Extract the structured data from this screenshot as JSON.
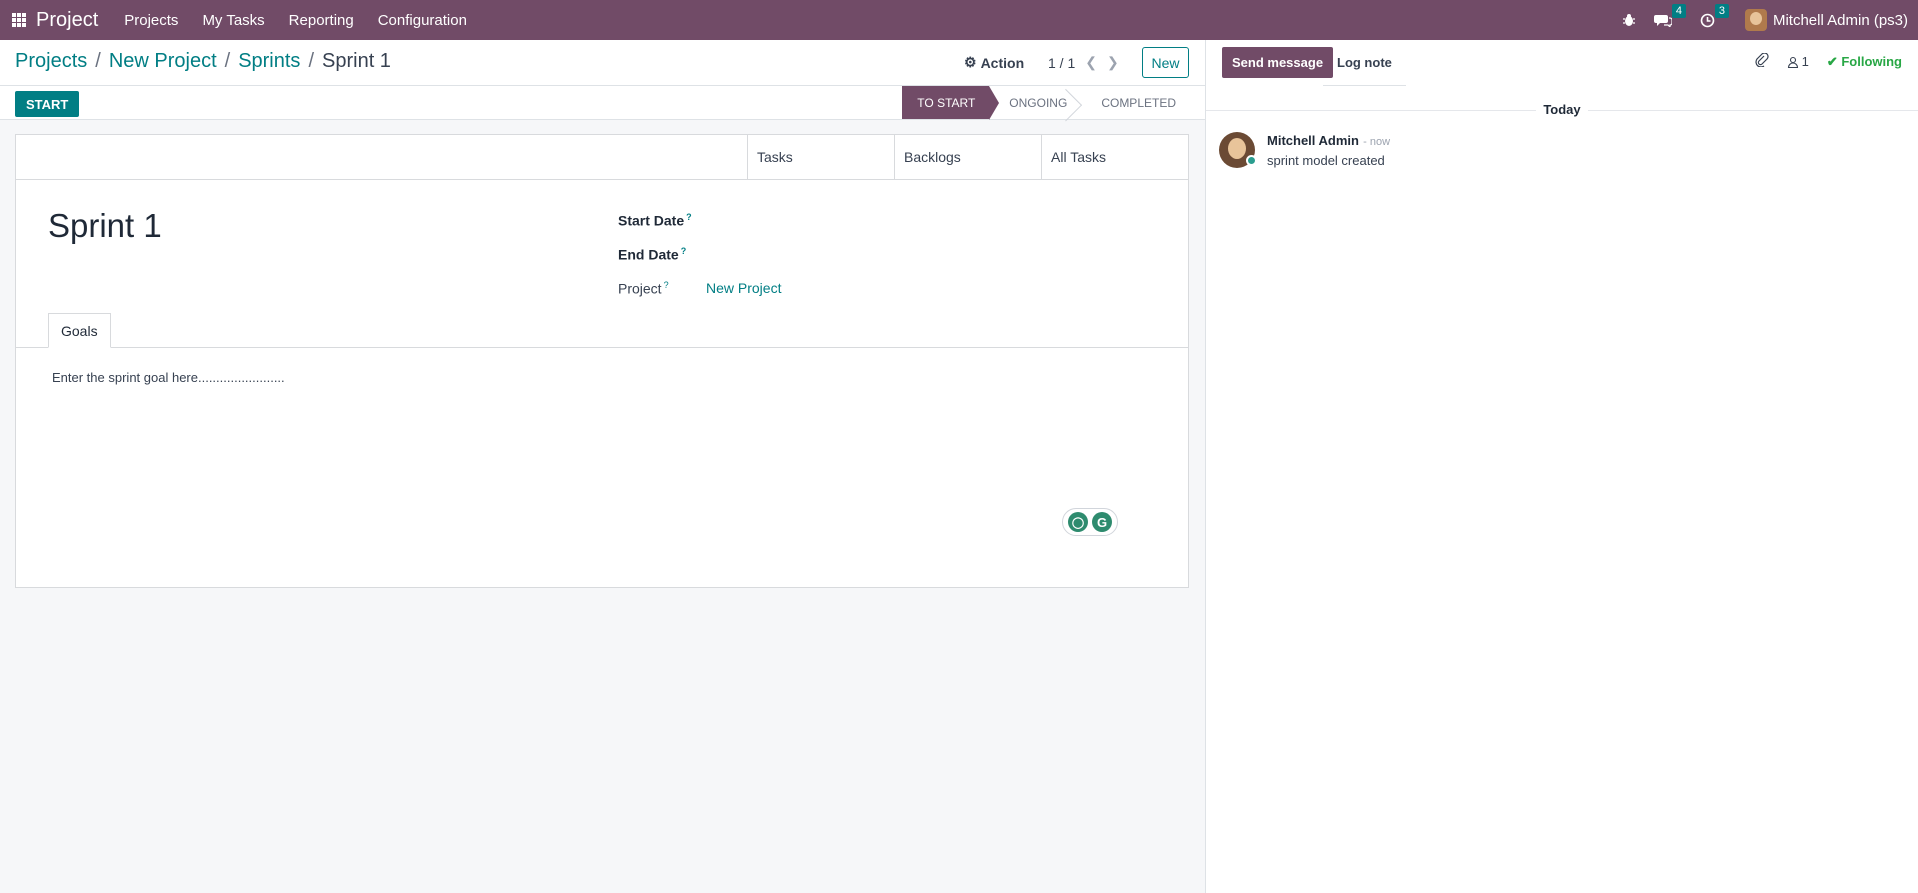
{
  "topbar": {
    "brand": "Project",
    "menu": [
      "Projects",
      "My Tasks",
      "Reporting",
      "Configuration"
    ],
    "messages_count": "4",
    "activities_count": "3",
    "user": "Mitchell Admin (ps3)"
  },
  "breadcrumb": {
    "items": [
      "Projects",
      "New Project",
      "Sprints"
    ],
    "current": "Sprint 1"
  },
  "control": {
    "action_label": "Action",
    "pager": "1 / 1",
    "new_label": "New"
  },
  "statusbar": {
    "start_label": "START",
    "stages": [
      "TO START",
      "ONGOING",
      "COMPLETED"
    ],
    "active_stage": "TO START"
  },
  "smart_buttons": [
    "Tasks",
    "Backlogs",
    "All Tasks"
  ],
  "record": {
    "title": "Sprint 1",
    "fields": {
      "start_date_label": "Start Date",
      "end_date_label": "End Date",
      "project_label": "Project",
      "project_value": "New Project"
    },
    "tab_goals": "Goals",
    "goal_text": "Enter the sprint goal here........................"
  },
  "chatter": {
    "send_label": "Send message",
    "log_label": "Log note",
    "followers_count": "1",
    "following_label": "Following",
    "today_label": "Today",
    "message": {
      "author": "Mitchell Admin",
      "time": "- now",
      "body": "sprint model created"
    }
  }
}
